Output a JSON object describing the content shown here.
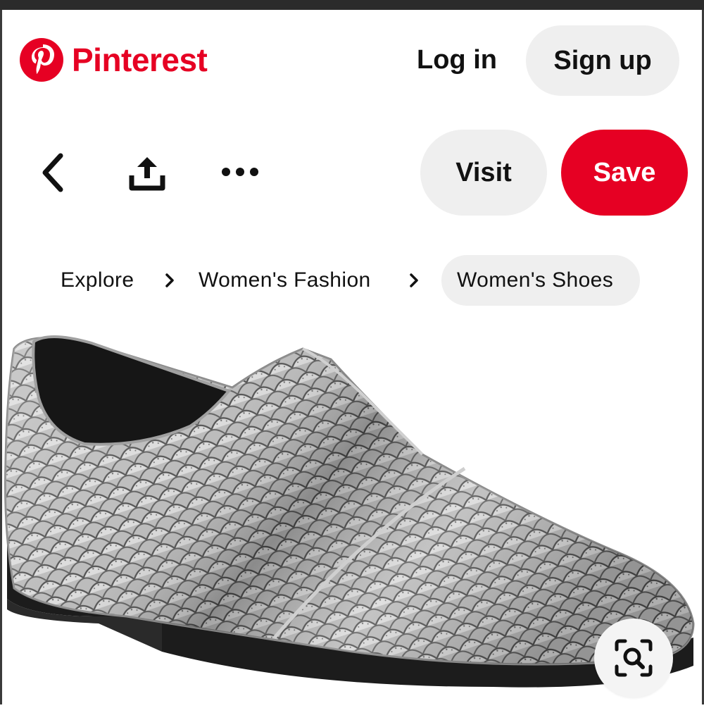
{
  "header": {
    "brand": "Pinterest",
    "login_label": "Log in",
    "signup_label": "Sign up"
  },
  "actions": {
    "visit_label": "Visit",
    "save_label": "Save"
  },
  "breadcrumb": {
    "items": [
      "Explore",
      "Women's Fashion",
      "Women's Shoes"
    ]
  },
  "pin": {
    "image_subject": "silver metallic snakeskin slip-on loafer"
  },
  "icons": {
    "logo": "pinterest-p-icon",
    "back": "chevron-left-icon",
    "share": "share-upload-icon",
    "more": "more-horizontal-icon",
    "crumb_separator": "chevron-right-icon",
    "visual_search": "visual-search-icon"
  },
  "colors": {
    "brand_red": "#e60023",
    "pill_gray": "#efefef",
    "text": "#111111"
  }
}
